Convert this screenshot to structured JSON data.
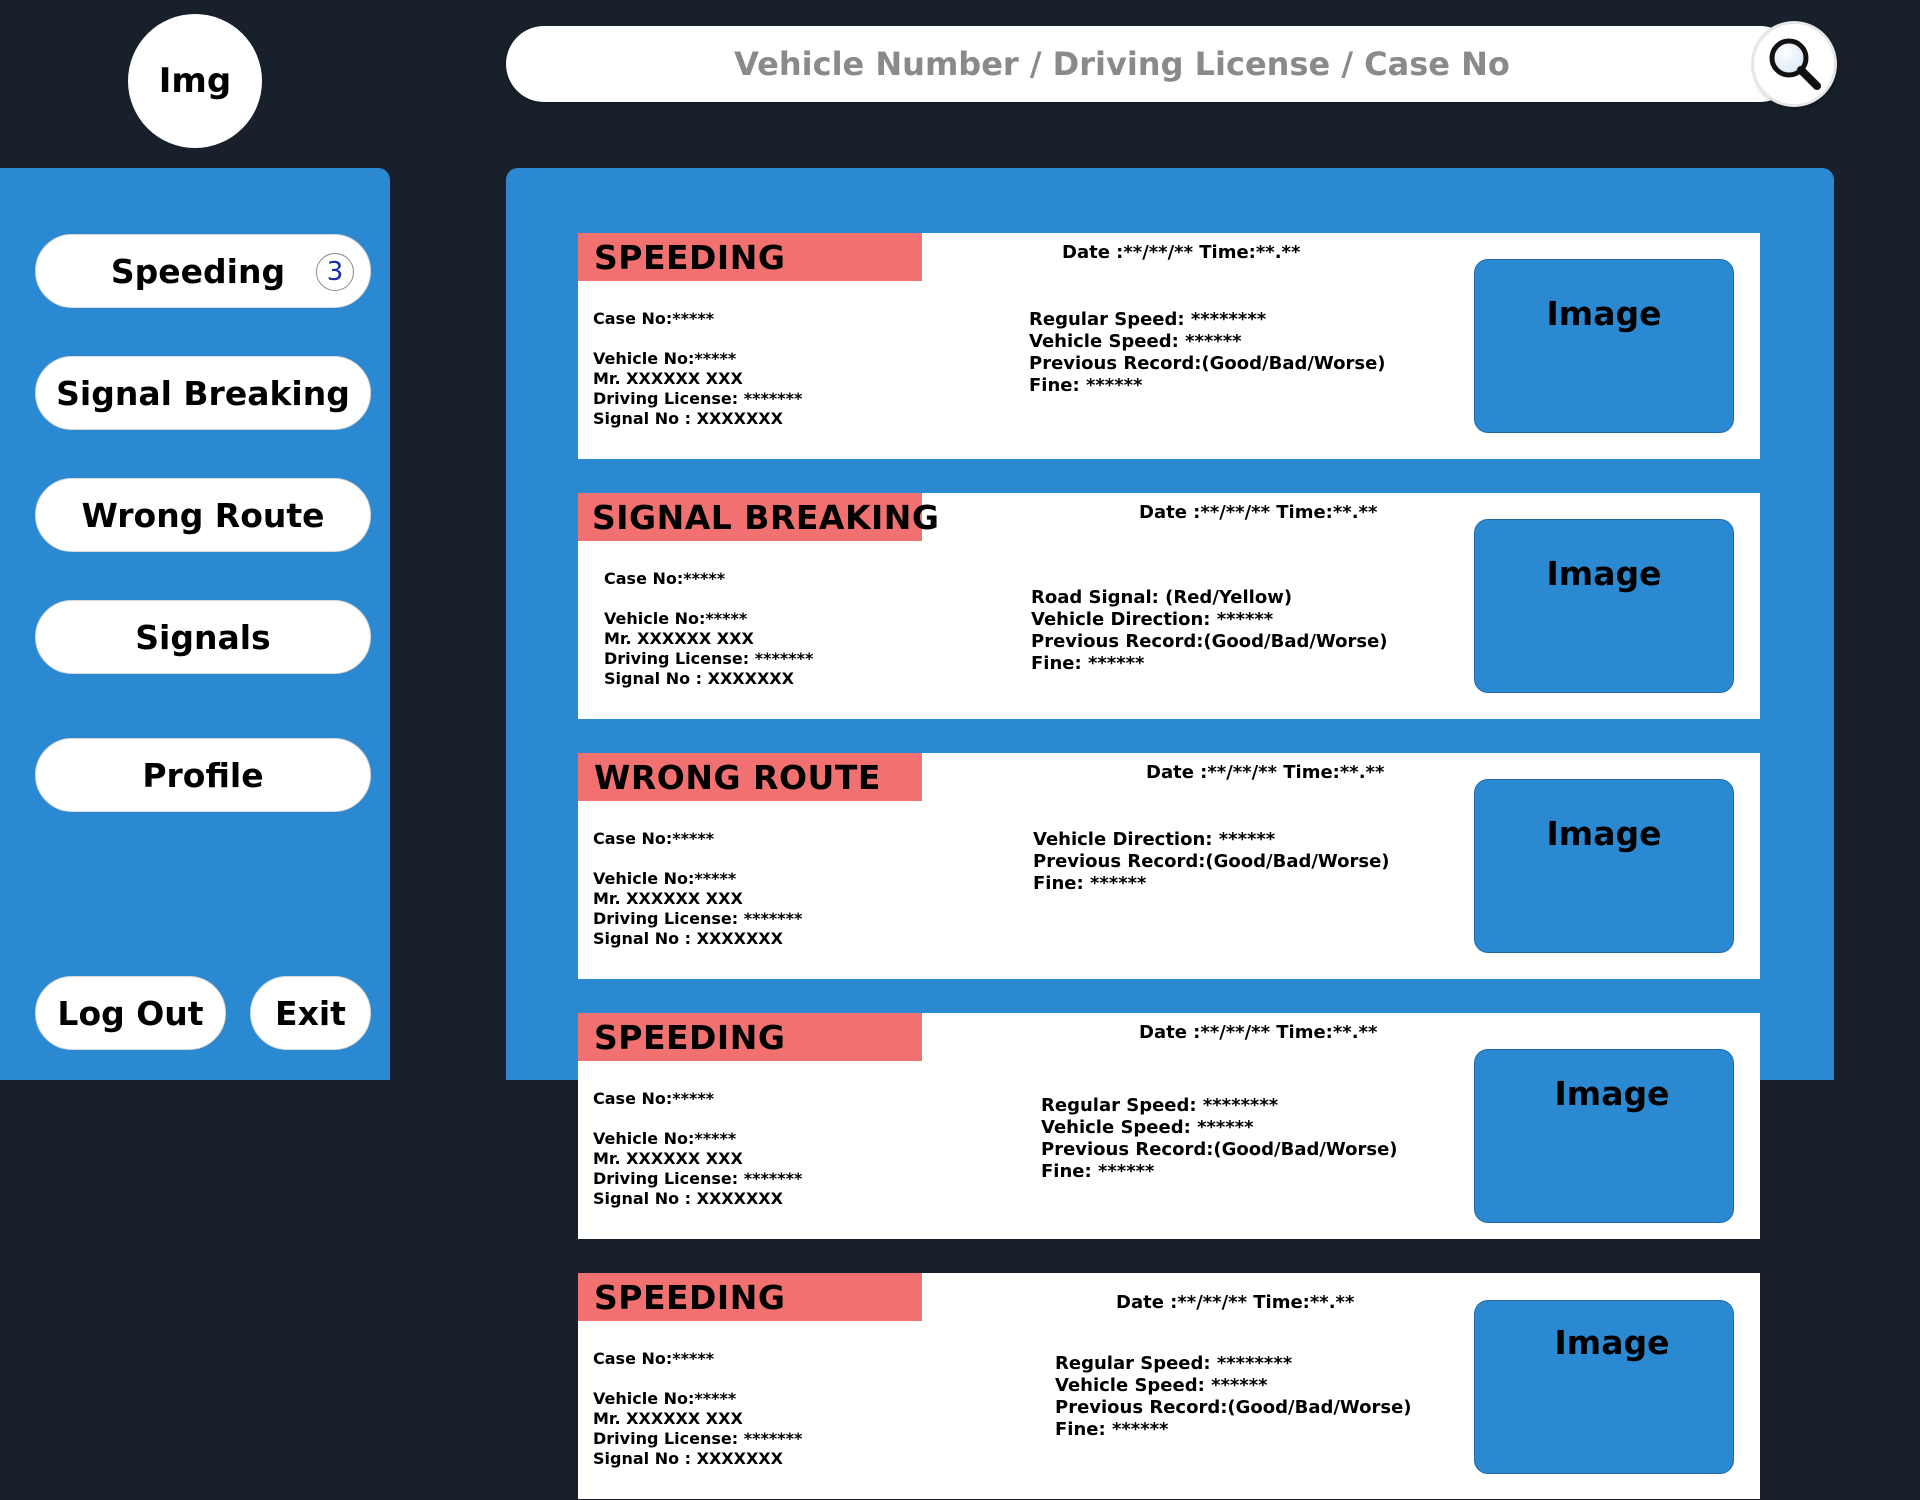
{
  "avatar": {
    "label": "Img"
  },
  "search": {
    "placeholder": "Vehicle Number / Driving License / Case No"
  },
  "sidebar": {
    "items": [
      {
        "label": "Speeding",
        "badge": "3"
      },
      {
        "label": "Signal Breaking"
      },
      {
        "label": "Wrong Route"
      },
      {
        "label": "Signals"
      },
      {
        "label": "Profile"
      }
    ],
    "logout_label": "Log Out",
    "exit_label": "Exit"
  },
  "cards": [
    {
      "title": "SPEEDING",
      "datetime": "Date :**/**/** Time:**.**",
      "case_no": "Case No:*****",
      "vehicle_no": "Vehicle No:*****",
      "owner": "Mr. XXXXXX XXX",
      "license": "Driving License: *******",
      "signal_no": "Signal No : XXXXXXX",
      "details": [
        "Regular Speed: ********",
        "Vehicle Speed: ******",
        "Previous Record:(Good/Bad/Worse)",
        "Fine: ******"
      ],
      "image_label": "Image"
    },
    {
      "title": "SIGNAL BREAKING",
      "datetime": "Date :**/**/** Time:**.**",
      "case_no": "Case No:*****",
      "vehicle_no": "Vehicle No:*****",
      "owner": "Mr. XXXXXX XXX",
      "license": "Driving License: *******",
      "signal_no": "Signal No : XXXXXXX",
      "details": [
        "Road Signal: (Red/Yellow)",
        "Vehicle Direction: ******",
        "Previous Record:(Good/Bad/Worse)",
        "Fine: ******"
      ],
      "image_label": "Image"
    },
    {
      "title": "WRONG ROUTE",
      "datetime": "Date :**/**/** Time:**.**",
      "case_no": "Case No:*****",
      "vehicle_no": "Vehicle No:*****",
      "owner": "Mr. XXXXXX XXX",
      "license": "Driving License: *******",
      "signal_no": "Signal No : XXXXXXX",
      "details": [
        "Vehicle Direction: ******",
        "Previous Record:(Good/Bad/Worse)",
        "Fine: ******"
      ],
      "image_label": "Image"
    },
    {
      "title": "SPEEDING",
      "datetime": "Date :**/**/** Time:**.**",
      "case_no": "Case No:*****",
      "vehicle_no": "Vehicle No:*****",
      "owner": "Mr. XXXXXX XXX",
      "license": "Driving License: *******",
      "signal_no": "Signal No : XXXXXXX",
      "details": [
        "Regular Speed: ********",
        "Vehicle Speed: ******",
        "Previous Record:(Good/Bad/Worse)",
        "Fine: ******"
      ],
      "image_label": "Image"
    },
    {
      "title": "SPEEDING",
      "datetime": "Date :**/**/** Time:**.**",
      "case_no": "Case No:*****",
      "vehicle_no": "Vehicle No:*****",
      "owner": "Mr. XXXXXX XXX",
      "license": "Driving License: *******",
      "signal_no": "Signal No : XXXXXXX",
      "details": [
        "Regular Speed: ********",
        "Vehicle Speed: ******",
        "Previous Record:(Good/Bad/Worse)",
        "Fine: ******"
      ],
      "image_label": "Image"
    }
  ]
}
